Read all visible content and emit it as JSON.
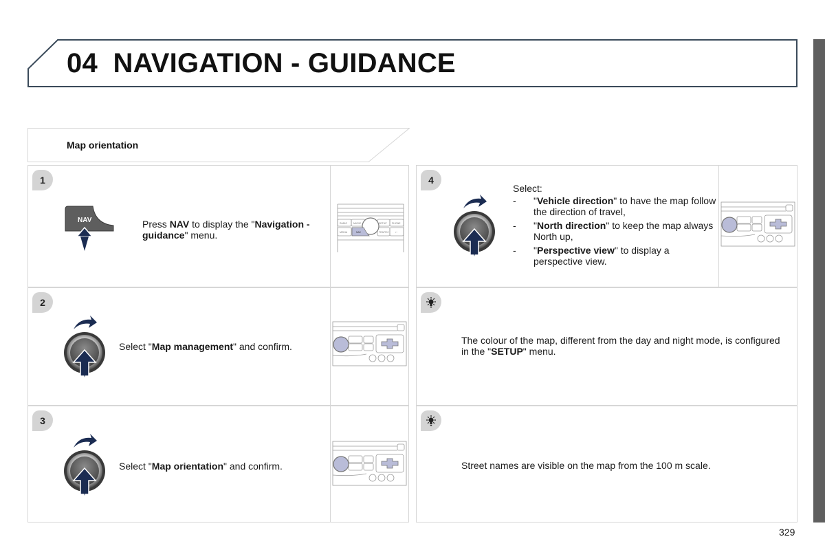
{
  "header": {
    "chapter_number": "04",
    "chapter_title": "NAVIGATION - GUIDANCE"
  },
  "section": {
    "title": "Map orientation"
  },
  "steps": [
    {
      "number": "1",
      "icon": "nav-button-press-icon",
      "nav_key_label": "NAV",
      "text_parts": [
        "Press ",
        "NAV",
        " to display the \"",
        "Navigation - guidance",
        "\" menu."
      ],
      "illustration": "radio-front-panel-nav-highlighted",
      "panel_button_labels": [
        "RADIO",
        "MUSIC",
        "SETUP",
        "PHONE",
        "MEDIA",
        "NAV",
        "TRAFFIC"
      ]
    },
    {
      "number": "2",
      "icon": "rotary-knob-turn-press-icon",
      "text_parts": [
        "Select \"",
        "Map management",
        "\" and confirm."
      ],
      "illustration": "radio-front-panel-knob-highlighted"
    },
    {
      "number": "3",
      "icon": "rotary-knob-turn-press-icon",
      "text_parts": [
        "Select \"",
        "Map orientation",
        "\" and confirm."
      ],
      "illustration": "radio-front-panel-knob-highlighted"
    },
    {
      "number": "4",
      "icon": "rotary-knob-turn-press-icon",
      "intro": "Select:",
      "options": [
        {
          "name": "Vehicle direction",
          "desc": " to have the map follow the direction of travel,"
        },
        {
          "name": "North direction",
          "desc": " to keep the map always North up,"
        },
        {
          "name": "Perspective view",
          "desc": " to display a perspective view."
        }
      ],
      "illustration": "radio-front-panel-knob-highlighted"
    }
  ],
  "tips": [
    {
      "icon": "lightbulb-tip-icon",
      "text_parts": [
        "The colour of the map, different from the day and night mode, is configured in the \"",
        "SETUP",
        "\" menu."
      ]
    },
    {
      "icon": "lightbulb-tip-icon",
      "text_parts": [
        "Street names are visible on the map from the 100 m scale."
      ]
    }
  ],
  "footer": {
    "page_number": "329"
  },
  "colors": {
    "arrow_navy": "#1b2c52",
    "side_tab": "#5f5f5f",
    "badge_bg": "#d4d4d4",
    "border": "#d6d6d6",
    "header_border": "#3a4a5a",
    "nav_highlight": "#b9bcd8"
  }
}
